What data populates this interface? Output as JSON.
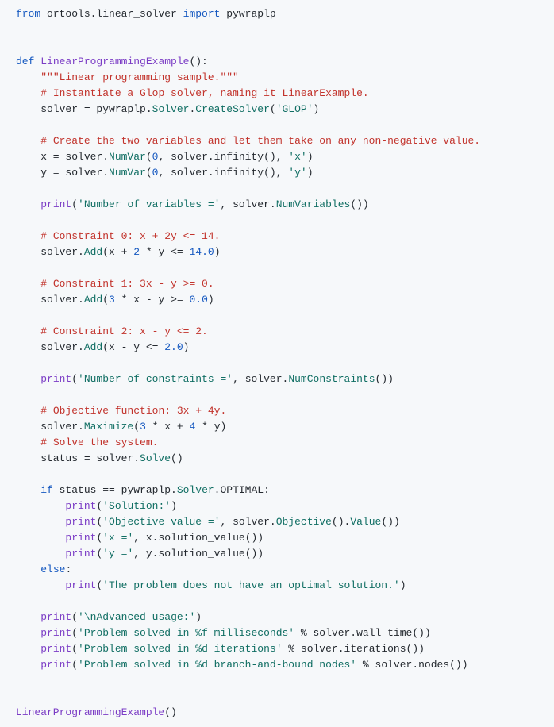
{
  "code": {
    "lines": [
      [
        [
          "kw",
          "from"
        ],
        [
          "name",
          " ortools.linear_solver "
        ],
        [
          "kw",
          "import"
        ],
        [
          "name",
          " pywraplp"
        ]
      ],
      [],
      [],
      [
        [
          "kw",
          "def"
        ],
        [
          "name",
          " "
        ],
        [
          "fn",
          "LinearProgrammingExample"
        ],
        [
          "name",
          "():"
        ]
      ],
      [
        [
          "name",
          "    "
        ],
        [
          "strred",
          "\"\"\"Linear programming sample.\"\"\""
        ]
      ],
      [
        [
          "name",
          "    "
        ],
        [
          "cmt",
          "# Instantiate a Glop solver, naming it LinearExample."
        ]
      ],
      [
        [
          "name",
          "    solver = pywraplp."
        ],
        [
          "cls",
          "Solver"
        ],
        [
          "name",
          "."
        ],
        [
          "cls",
          "CreateSolver"
        ],
        [
          "name",
          "("
        ],
        [
          "str",
          "'GLOP'"
        ],
        [
          "name",
          ")"
        ]
      ],
      [],
      [
        [
          "name",
          "    "
        ],
        [
          "cmt",
          "# Create the two variables and let them take on any non-negative value."
        ]
      ],
      [
        [
          "name",
          "    x = solver."
        ],
        [
          "cls",
          "NumVar"
        ],
        [
          "name",
          "("
        ],
        [
          "num",
          "0"
        ],
        [
          "name",
          ", solver.infinity(), "
        ],
        [
          "str",
          "'x'"
        ],
        [
          "name",
          ")"
        ]
      ],
      [
        [
          "name",
          "    y = solver."
        ],
        [
          "cls",
          "NumVar"
        ],
        [
          "name",
          "("
        ],
        [
          "num",
          "0"
        ],
        [
          "name",
          ", solver.infinity(), "
        ],
        [
          "str",
          "'y'"
        ],
        [
          "name",
          ")"
        ]
      ],
      [],
      [
        [
          "name",
          "    "
        ],
        [
          "fn",
          "print"
        ],
        [
          "name",
          "("
        ],
        [
          "str",
          "'Number of variables ='"
        ],
        [
          "name",
          ", solver."
        ],
        [
          "cls",
          "NumVariables"
        ],
        [
          "name",
          "())"
        ]
      ],
      [],
      [
        [
          "name",
          "    "
        ],
        [
          "cmt",
          "# Constraint 0: x + 2y <= 14."
        ]
      ],
      [
        [
          "name",
          "    solver."
        ],
        [
          "cls",
          "Add"
        ],
        [
          "name",
          "(x + "
        ],
        [
          "num",
          "2"
        ],
        [
          "name",
          " * y <= "
        ],
        [
          "num",
          "14.0"
        ],
        [
          "name",
          ")"
        ]
      ],
      [],
      [
        [
          "name",
          "    "
        ],
        [
          "cmt",
          "# Constraint 1: 3x - y >= 0."
        ]
      ],
      [
        [
          "name",
          "    solver."
        ],
        [
          "cls",
          "Add"
        ],
        [
          "name",
          "("
        ],
        [
          "num",
          "3"
        ],
        [
          "name",
          " * x - y >= "
        ],
        [
          "num",
          "0.0"
        ],
        [
          "name",
          ")"
        ]
      ],
      [],
      [
        [
          "name",
          "    "
        ],
        [
          "cmt",
          "# Constraint 2: x - y <= 2."
        ]
      ],
      [
        [
          "name",
          "    solver."
        ],
        [
          "cls",
          "Add"
        ],
        [
          "name",
          "(x - y <= "
        ],
        [
          "num",
          "2.0"
        ],
        [
          "name",
          ")"
        ]
      ],
      [],
      [
        [
          "name",
          "    "
        ],
        [
          "fn",
          "print"
        ],
        [
          "name",
          "("
        ],
        [
          "str",
          "'Number of constraints ='"
        ],
        [
          "name",
          ", solver."
        ],
        [
          "cls",
          "NumConstraints"
        ],
        [
          "name",
          "())"
        ]
      ],
      [],
      [
        [
          "name",
          "    "
        ],
        [
          "cmt",
          "# Objective function: 3x + 4y."
        ]
      ],
      [
        [
          "name",
          "    solver."
        ],
        [
          "cls",
          "Maximize"
        ],
        [
          "name",
          "("
        ],
        [
          "num",
          "3"
        ],
        [
          "name",
          " * x + "
        ],
        [
          "num",
          "4"
        ],
        [
          "name",
          " * y)"
        ]
      ],
      [
        [
          "name",
          "    "
        ],
        [
          "cmt",
          "# Solve the system."
        ]
      ],
      [
        [
          "name",
          "    status = solver."
        ],
        [
          "cls",
          "Solve"
        ],
        [
          "name",
          "()"
        ]
      ],
      [],
      [
        [
          "name",
          "    "
        ],
        [
          "kw",
          "if"
        ],
        [
          "name",
          " status == pywraplp."
        ],
        [
          "cls",
          "Solver"
        ],
        [
          "name",
          ".OPTIMAL:"
        ]
      ],
      [
        [
          "name",
          "        "
        ],
        [
          "fn",
          "print"
        ],
        [
          "name",
          "("
        ],
        [
          "str",
          "'Solution:'"
        ],
        [
          "name",
          ")"
        ]
      ],
      [
        [
          "name",
          "        "
        ],
        [
          "fn",
          "print"
        ],
        [
          "name",
          "("
        ],
        [
          "str",
          "'Objective value ='"
        ],
        [
          "name",
          ", solver."
        ],
        [
          "cls",
          "Objective"
        ],
        [
          "name",
          "()."
        ],
        [
          "cls",
          "Value"
        ],
        [
          "name",
          "())"
        ]
      ],
      [
        [
          "name",
          "        "
        ],
        [
          "fn",
          "print"
        ],
        [
          "name",
          "("
        ],
        [
          "str",
          "'x ='"
        ],
        [
          "name",
          ", x.solution_value())"
        ]
      ],
      [
        [
          "name",
          "        "
        ],
        [
          "fn",
          "print"
        ],
        [
          "name",
          "("
        ],
        [
          "str",
          "'y ='"
        ],
        [
          "name",
          ", y.solution_value())"
        ]
      ],
      [
        [
          "name",
          "    "
        ],
        [
          "kw",
          "else"
        ],
        [
          "name",
          ":"
        ]
      ],
      [
        [
          "name",
          "        "
        ],
        [
          "fn",
          "print"
        ],
        [
          "name",
          "("
        ],
        [
          "str",
          "'The problem does not have an optimal solution.'"
        ],
        [
          "name",
          ")"
        ]
      ],
      [],
      [
        [
          "name",
          "    "
        ],
        [
          "fn",
          "print"
        ],
        [
          "name",
          "("
        ],
        [
          "str",
          "'\\nAdvanced usage:'"
        ],
        [
          "name",
          ")"
        ]
      ],
      [
        [
          "name",
          "    "
        ],
        [
          "fn",
          "print"
        ],
        [
          "name",
          "("
        ],
        [
          "str",
          "'Problem solved in %f milliseconds'"
        ],
        [
          "name",
          " % solver.wall_time())"
        ]
      ],
      [
        [
          "name",
          "    "
        ],
        [
          "fn",
          "print"
        ],
        [
          "name",
          "("
        ],
        [
          "str",
          "'Problem solved in %d iterations'"
        ],
        [
          "name",
          " % solver.iterations())"
        ]
      ],
      [
        [
          "name",
          "    "
        ],
        [
          "fn",
          "print"
        ],
        [
          "name",
          "("
        ],
        [
          "str",
          "'Problem solved in %d branch-and-bound nodes'"
        ],
        [
          "name",
          " % solver.nodes())"
        ]
      ],
      [],
      [],
      [
        [
          "fn",
          "LinearProgrammingExample"
        ],
        [
          "name",
          "()"
        ]
      ]
    ]
  }
}
